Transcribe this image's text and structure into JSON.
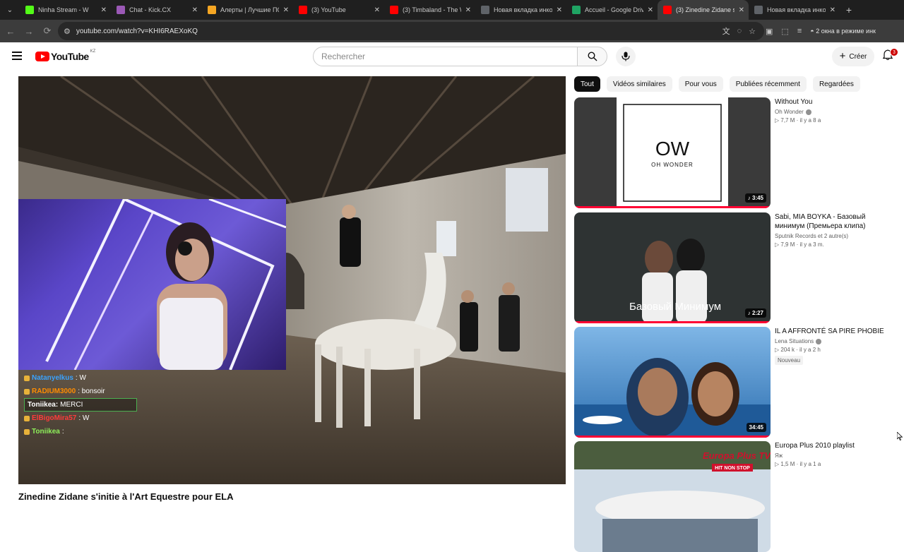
{
  "browser": {
    "tabs": [
      {
        "title": "Ninha Stream - W",
        "favicon": "kick-icon",
        "color": "#53fc18"
      },
      {
        "title": "Chat - Kick.CX",
        "favicon": "kick-chat-icon",
        "color": "#9b59b6"
      },
      {
        "title": "Алерты | Лучшие ПО",
        "favicon": "donationalerts-icon",
        "color": "#f5a623"
      },
      {
        "title": "(3) YouTube",
        "favicon": "youtube-icon",
        "color": "#ff0000"
      },
      {
        "title": "(3) Timbaland - The W",
        "favicon": "youtube-icon",
        "color": "#ff0000"
      },
      {
        "title": "Новая вкладка инкогн",
        "favicon": "incognito-icon",
        "color": "#5f6368"
      },
      {
        "title": "Accueil - Google Drive",
        "favicon": "google-drive-icon",
        "color": "#1fa463"
      },
      {
        "title": "(3) Zinedine Zidane s",
        "favicon": "youtube-icon",
        "color": "#ff0000"
      },
      {
        "title": "Новая вкладка инкогн",
        "favicon": "incognito-icon",
        "color": "#5f6368"
      }
    ],
    "active_tab_index": 7,
    "url": "youtube.com/watch?v=KHI6RAEXoKQ",
    "incognito_text": "2 окна в режиме инк"
  },
  "youtube": {
    "logo_text": "YouTube",
    "country_code": "KZ",
    "search_placeholder": "Rechercher",
    "create_label": "Créer",
    "notifications_count": "3"
  },
  "overlay": {
    "chat": [
      {
        "user": "Natanyelkus",
        "message": ": W",
        "user_color": "#3aa3ff"
      },
      {
        "user": "RADIUM3000",
        "message": ": bonsoir",
        "user_color": "#ff8c00"
      },
      {
        "user": "Toniikea:",
        "message": "MERCI",
        "user_color": "#ffffff",
        "highlight": true
      },
      {
        "user": "ElBigoMira57",
        "message": ": W",
        "user_color": "#ff3b3b"
      },
      {
        "user": "Toniikea",
        "message": ":",
        "user_color": "#8ef05a"
      }
    ]
  },
  "video": {
    "title": "Zinedine Zidane s'initie à l'Art Equestre pour ELA"
  },
  "chips": [
    {
      "label": "Tout",
      "active": true
    },
    {
      "label": "Vidéos similaires",
      "active": false
    },
    {
      "label": "Pour vous",
      "active": false
    },
    {
      "label": "Publiées récemment",
      "active": false
    },
    {
      "label": "Regardées",
      "active": false
    }
  ],
  "recommendations": [
    {
      "title": "Without You",
      "channel": "Oh Wonder",
      "verified": true,
      "stats": "▷ 7,7 M · il y a 8 a",
      "duration": "♪ 3:45",
      "badge": "",
      "thumb_text": "OW",
      "thumb_subtext": "OH WONDER"
    },
    {
      "title": "Sabi, MIA BOYKA - Базовый минимум (Премьера клипа)",
      "channel": "Sputnik Records et 2 autre(s)",
      "verified": false,
      "stats": "▷ 7,9 M · il y a 3 m.",
      "duration": "♪ 2:27",
      "badge": "",
      "thumb_text": "Базовый Минимум"
    },
    {
      "title": "IL A AFFRONTÉ SA PIRE PHOBIE",
      "channel": "Lena Situations",
      "verified": true,
      "stats": "▷ 204 k · il y a 2 h",
      "duration": "34:45",
      "badge": "Nouveau"
    },
    {
      "title": "Europa Plus 2010 playlist",
      "channel": "Яж",
      "verified": false,
      "stats": "▷ 1,5 M · il y a 1 a",
      "duration": "",
      "badge": "",
      "thumb_text": "Europa Plus TV",
      "thumb_subtext": "HIT NON STOP"
    }
  ]
}
